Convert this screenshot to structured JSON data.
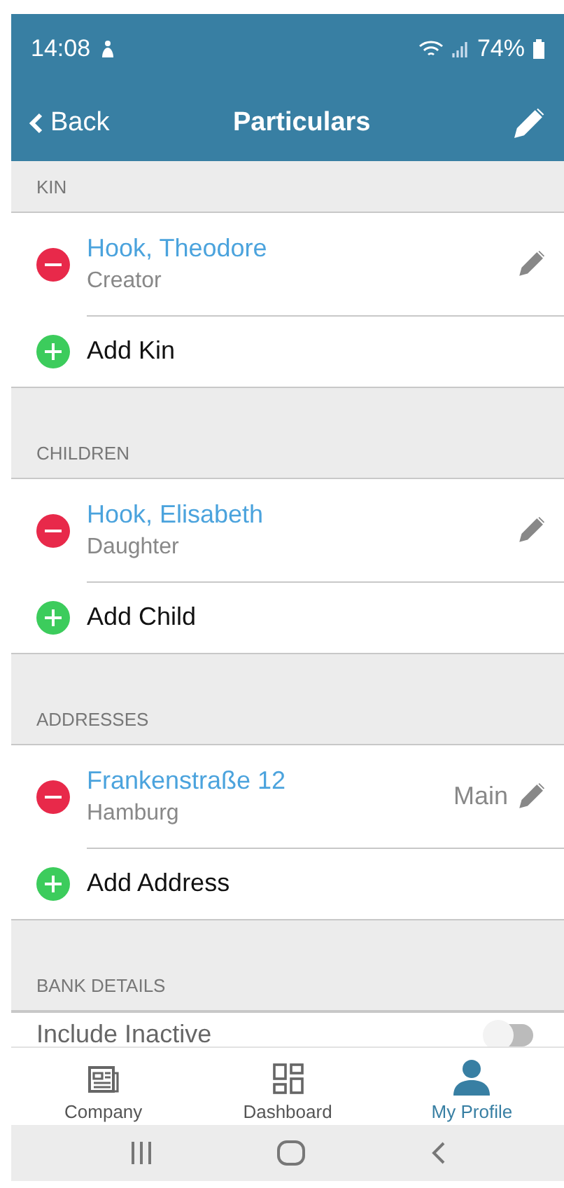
{
  "status_bar": {
    "time": "14:08",
    "battery": "74%"
  },
  "header": {
    "back": "Back",
    "title": "Particulars"
  },
  "sections": [
    {
      "title": "KIN",
      "items": [
        {
          "name": "Hook, Theodore",
          "detail": "Creator"
        }
      ],
      "add": "Add Kin"
    },
    {
      "title": "CHILDREN",
      "items": [
        {
          "name": "Hook, Elisabeth",
          "detail": "Daughter"
        }
      ],
      "add": "Add Child"
    },
    {
      "title": "ADDRESSES",
      "items": [
        {
          "name": "Frankenstraße 12",
          "detail": "Hamburg",
          "tag": "Main"
        }
      ],
      "add": "Add Address"
    },
    {
      "title": "BANK DETAILS",
      "toggle": {
        "label": "Include Inactive",
        "on": false
      }
    }
  ],
  "tabs": [
    {
      "label": "Company",
      "kind": "news",
      "selected": false
    },
    {
      "label": "Dashboard",
      "kind": "grid",
      "selected": false
    },
    {
      "label": "My Profile",
      "kind": "person",
      "selected": true
    }
  ]
}
